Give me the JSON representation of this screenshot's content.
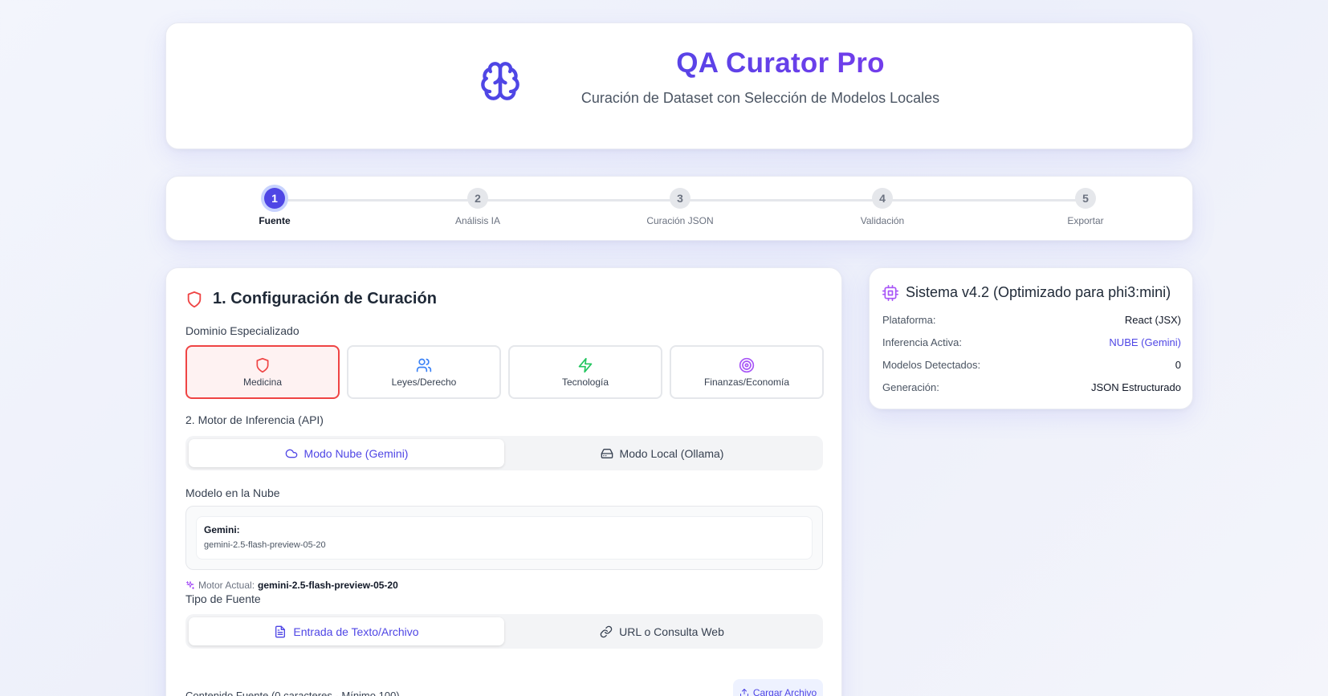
{
  "header": {
    "title": "QA Curator Pro",
    "subtitle": "Curación de Dataset con Selección de Modelos Locales",
    "icon": "brain-icon"
  },
  "stepper": {
    "steps": [
      {
        "number": "1",
        "label": "Fuente",
        "active": true
      },
      {
        "number": "2",
        "label": "Análisis IA",
        "active": false
      },
      {
        "number": "3",
        "label": "Curación JSON",
        "active": false
      },
      {
        "number": "4",
        "label": "Validación",
        "active": false
      },
      {
        "number": "5",
        "label": "Exportar",
        "active": false
      }
    ]
  },
  "config": {
    "title": "1. Configuración de Curación",
    "domain_label": "Dominio Especializado",
    "domains": [
      {
        "label": "Medicina",
        "icon": "shield-icon",
        "selected": true
      },
      {
        "label": "Leyes/Derecho",
        "icon": "users-icon",
        "selected": false
      },
      {
        "label": "Tecnología",
        "icon": "zap-icon",
        "selected": false
      },
      {
        "label": "Finanzas/Economía",
        "icon": "target-icon",
        "selected": false
      }
    ],
    "engine_label": "2. Motor de Inferencia (API)",
    "engine_modes": [
      {
        "label": "Modo Nube (Gemini)",
        "icon": "cloud-icon",
        "active": true
      },
      {
        "label": "Modo Local (Ollama)",
        "icon": "hard-drive-icon",
        "active": false
      }
    ],
    "cloud_model_label": "Modelo en la Nube",
    "model": {
      "name": "Gemini:",
      "id": "gemini-2.5-flash-preview-05-20"
    },
    "motor_actual_prefix": "Motor Actual:",
    "motor_actual_value": "gemini-2.5-flash-preview-05-20",
    "source_type_label": "Tipo de Fuente",
    "source_modes": [
      {
        "label": "Entrada de Texto/Archivo",
        "icon": "file-text-icon",
        "active": true
      },
      {
        "label": "URL o Consulta Web",
        "icon": "link-icon",
        "active": false
      }
    ],
    "content_label": "Contenido Fuente (0 caracteres - Mínimo 100)",
    "upload_button": "Cargar Archivo"
  },
  "system": {
    "title": "Sistema v4.2 (Optimizado para phi3:mini)",
    "rows": [
      {
        "label": "Plataforma:",
        "value": "React (JSX)"
      },
      {
        "label": "Inferencia Activa:",
        "value": "NUBE (Gemini)"
      },
      {
        "label": "Modelos Detectados:",
        "value": "0"
      },
      {
        "label": "Generación:",
        "value": "JSON Estructurado"
      }
    ]
  },
  "colors": {
    "accent": "#4f46e5",
    "purple": "#7c3aed",
    "danger": "#ef4444",
    "success": "#22c55e"
  }
}
